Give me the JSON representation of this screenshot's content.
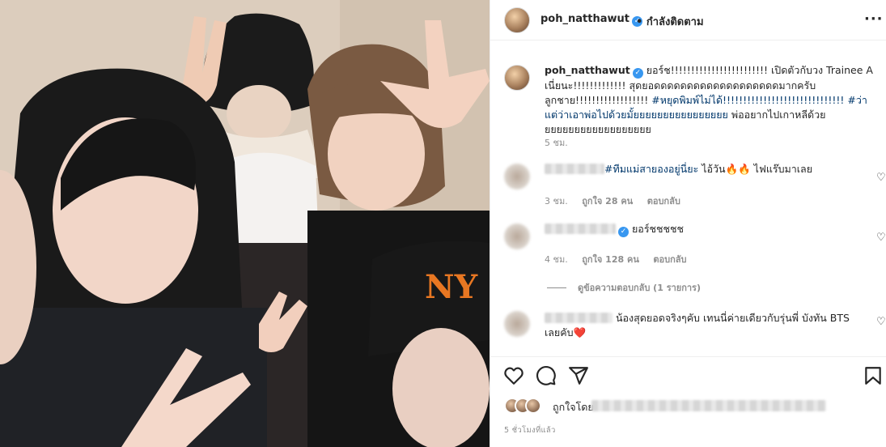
{
  "header": {
    "username": "poh_natthawut",
    "separator": "•",
    "follow_state": "กำลังติดตาม",
    "more": "···"
  },
  "caption": {
    "username": "poh_natthawut",
    "text_part1": "ยอร์ช!!!!!!!!!!!!!!!!!!!!!!!! เปิดตัวกับวง Trainee A เนี่ยนะ!!!!!!!!!!!!! สุดยอดดดดดดดดดดดดดดดดดดดมากครับลูกชาย!!!!!!!!!!!!!!!!!! ",
    "hashtag1": "#หยุดพิมพ์ไม่ได้!!!!!!!!!!!!!!!!!!!!!!!!!!!!!!",
    "hashtag2": "#ว่าแต่ว่าเอาพ่อไปด้วยมั้ยยยยยยยยยยยยยยยย",
    "text_part2": " พ่ออยากไปเกาหลีด้วยยยยยยยยยยยยยยยยยยย",
    "time": "5 ชม."
  },
  "comments": [
    {
      "hashtag": "#ทีมแม่สายองอยู่นี่ยะ",
      "text": " ไอ้วัน🔥🔥 ไฟแร๊บมาเลย",
      "time": "3 ชม.",
      "likes": "ถูกใจ 28 คน",
      "reply": "ตอบกลับ"
    },
    {
      "text": "ยอร์ชชชชช",
      "time": "4 ชม.",
      "likes": "ถูกใจ 128 คน",
      "reply": "ตอบกลับ"
    },
    {
      "text": "น้องสุดยอดจริงๆคับ เทนนี่ค่ายเดียวกับรุ่นพี่ บังทัน BTS เลยคับ❤️"
    }
  ],
  "view_replies": "ดูข้อความตอบกลับ (1 รายการ)",
  "liked_by": "ถูกใจโดย",
  "posted_time": "5 ชั่วโมงที่แล้ว",
  "icons": [
    "heart-icon",
    "comment-icon",
    "share-icon",
    "bookmark-icon",
    "more-icon",
    "verified-icon"
  ],
  "colors": {
    "hashtag": "#00376b",
    "verified": "#3897f0",
    "meta": "#8e8e8e",
    "cap_orange": "#e87722"
  }
}
